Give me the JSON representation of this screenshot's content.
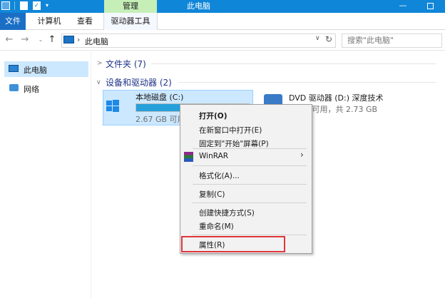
{
  "titlebar": {
    "contextual_tab": "管理",
    "window_title": "此电脑",
    "minimize": "—"
  },
  "ribbon": {
    "tabs": [
      "文件",
      "计算机",
      "查看",
      "驱动器工具"
    ]
  },
  "navigation": {
    "back": "←",
    "forward": "→",
    "up": "↑",
    "separator": "›",
    "address": "此电脑",
    "refresh": "↻",
    "search_placeholder": "搜索\"此电脑\""
  },
  "sidebar": {
    "items": [
      {
        "label": "此电脑",
        "icon": "monitor-icon",
        "selected": true
      },
      {
        "label": "网络",
        "icon": "network-icon",
        "selected": false
      }
    ]
  },
  "groups": [
    {
      "title": "文件夹 (7)",
      "collapsed": true
    },
    {
      "title": "设备和驱动器 (2)",
      "collapsed": false
    }
  ],
  "drives": [
    {
      "name": "本地磁盘 (C:)",
      "free_text": "2.67 GB 可用",
      "used_fraction": 0.63,
      "selected": true,
      "icon": "windows-drive-icon"
    },
    {
      "name": "DVD 驱动器 (D:) 深度技术",
      "free_text": "0 字节可用，共 2.73 GB",
      "icon": "dvd-drive-icon"
    }
  ],
  "context_menu": {
    "items": [
      {
        "label": "打开(O)",
        "bold": true
      },
      {
        "label": "在新窗口中打开(E)"
      },
      {
        "label": "固定到\"开始\"屏幕(P)"
      },
      {
        "label": "WinRAR",
        "submenu": true,
        "icon": "winrar-icon"
      },
      {
        "label": "格式化(A)..."
      },
      {
        "label": "复制(C)"
      },
      {
        "label": "创建快捷方式(S)"
      },
      {
        "label": "重命名(M)"
      },
      {
        "label": "属性(R)",
        "highlighted": true
      }
    ],
    "submenu_arrow": "›"
  },
  "colors": {
    "titlebar": "#1086d8",
    "contextual_tab": "#c6efb8",
    "selection": "#cce8ff",
    "highlight_box": "#e0363b",
    "group_title": "#1e3287"
  }
}
